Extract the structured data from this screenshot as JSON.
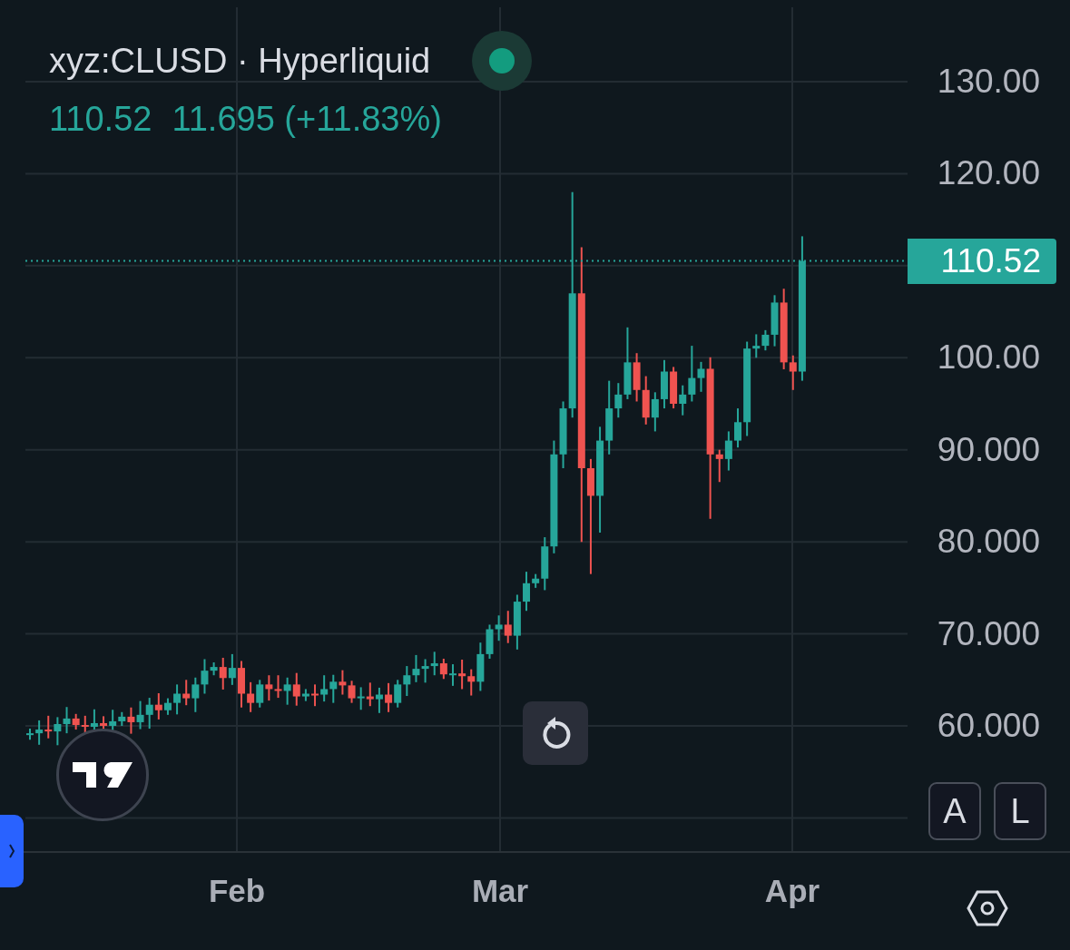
{
  "legend": {
    "title": "xyz:CLUSD · Hyperliquid",
    "live": true,
    "price": "110.52",
    "change": "11.695 (+11.83%)"
  },
  "price_axis": {
    "labels": [
      "130.00",
      "120.00",
      "110.52",
      "100.00",
      "90.000",
      "80.000",
      "70.000",
      "60.000"
    ]
  },
  "time_axis": {
    "labels": [
      "Feb",
      "Mar",
      "Apr"
    ]
  },
  "scale_buttons": [
    {
      "label": "A"
    },
    {
      "label": "L"
    }
  ]
}
